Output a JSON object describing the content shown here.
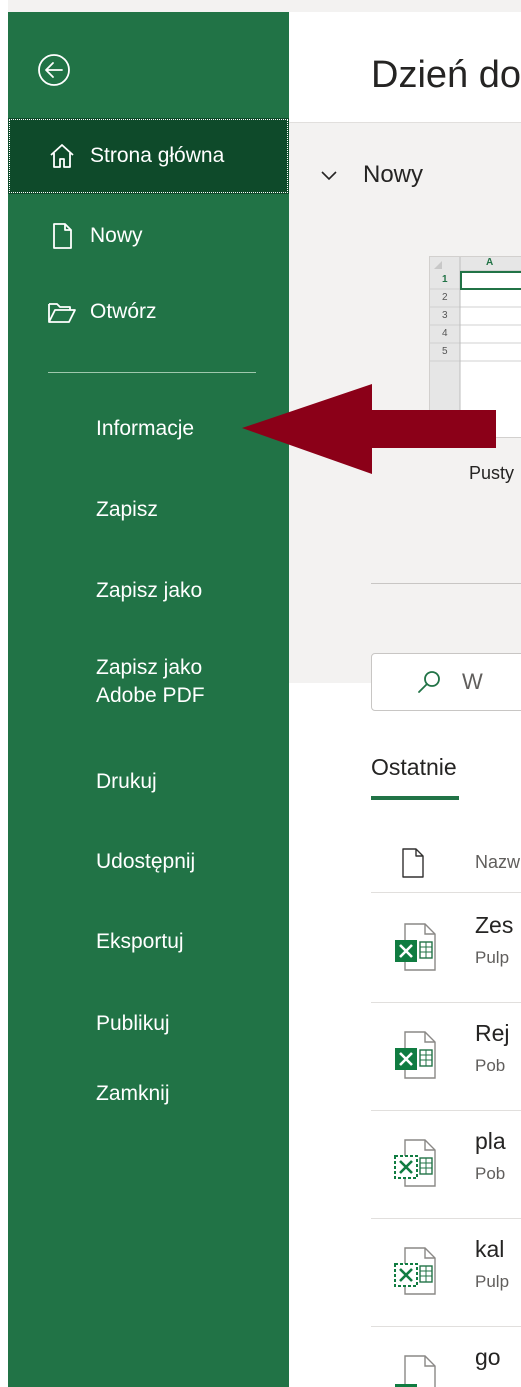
{
  "sidebar": {
    "back_label": "Wstecz",
    "nav_items": [
      {
        "label": "Strona główna",
        "icon": "home-icon",
        "selected": true
      },
      {
        "label": "Nowy",
        "icon": "new-document-icon",
        "selected": false
      },
      {
        "label": "Otwórz",
        "icon": "folder-open-icon",
        "selected": false
      }
    ],
    "sub_items": [
      "Informacje",
      "Zapisz",
      "Zapisz jako",
      "Zapisz jako Adobe PDF",
      "Drukuj",
      "Udostępnij",
      "Eksportuj",
      "Publikuj",
      "Zamknij"
    ],
    "colors": {
      "background": "#217346",
      "selected": "#0e4a2a"
    }
  },
  "main": {
    "greeting": "Dzień do",
    "new_section": {
      "label": "Nowy",
      "template_caption": "Pusty",
      "grid": {
        "column_header": "A",
        "rows": [
          "1",
          "2",
          "3",
          "4",
          "5"
        ]
      }
    },
    "search": {
      "text": "W"
    },
    "recent": {
      "tab_label": "Ostatnie",
      "header_label": "Nazw",
      "files": [
        {
          "name": "Zes",
          "path": "Pulp",
          "icon": "excel-file-icon"
        },
        {
          "name": "Rej",
          "path": "Pob",
          "icon": "excel-file-icon"
        },
        {
          "name": "pla",
          "path": "Pob",
          "icon": "excel-template-icon"
        },
        {
          "name": "kal",
          "path": "Pulp",
          "icon": "excel-template-icon"
        },
        {
          "name": "go",
          "path": "",
          "icon": "document-icon"
        }
      ]
    }
  },
  "annotation": {
    "color": "#8b0018"
  }
}
